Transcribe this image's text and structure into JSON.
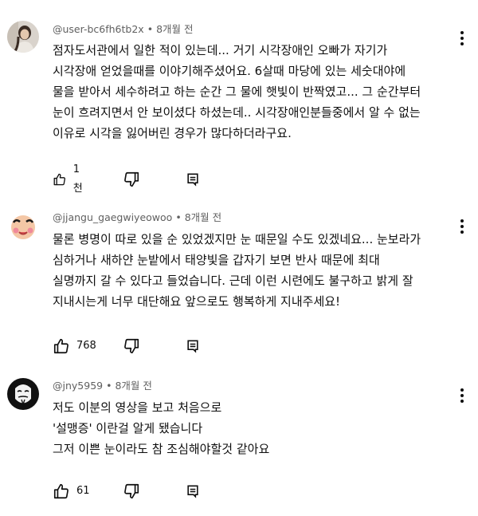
{
  "comments": [
    {
      "author": "@user-bc6fh6tb2x",
      "time": "8개월 전",
      "lines": [
        "점자도서관에서 일한 적이 있는데... 거기 시각장애인 오빠가 자기가",
        "시각장애 얻었을때를 이야기해주셨어요. 6살때 마당에 있는 세숫대야에",
        "물을 받아서 세수하려고 하는 순간 그 물에 햇빛이 반짝였고... 그 순간부터",
        "눈이 흐려지면서 안 보이셨다 하셨는데.. 시각장애인분들중에서 알 수 없는",
        "이유로 시각을 잃어버린 경우가 많다하더라구요."
      ],
      "likes": "1천"
    },
    {
      "author": "@jjangu_gaegwiyeowoo",
      "time": "8개월 전",
      "lines": [
        "물론 병명이 따로 있을 순 있었겠지만 눈 때문일 수도 있겠네요... 눈보라가",
        "심하거나 새하얀 눈밭에서 태양빛을 갑자기 보면 반사 때문에 최대",
        "실명까지 갈 수 있다고 들었습니다. 근데 이런 시련에도 불구하고 밝게 잘",
        "지내시는게 너무 대단해요 앞으로도 행복하게 지내주세요!"
      ],
      "likes": "768"
    },
    {
      "author": "@jny5959",
      "time": "8개월 전",
      "lines": [
        "저도 이분의 영상을 보고 처음으로",
        "'설맹증' 이란걸 알게 됐습니다",
        "그저 이쁜 눈이라도 참 조심해야할것 같아요"
      ],
      "likes": "61"
    }
  ],
  "icons": {
    "like": "thumb-up-icon",
    "dislike": "thumb-down-icon",
    "reply": "reply-comment-icon",
    "more": "more-vertical-icon"
  }
}
